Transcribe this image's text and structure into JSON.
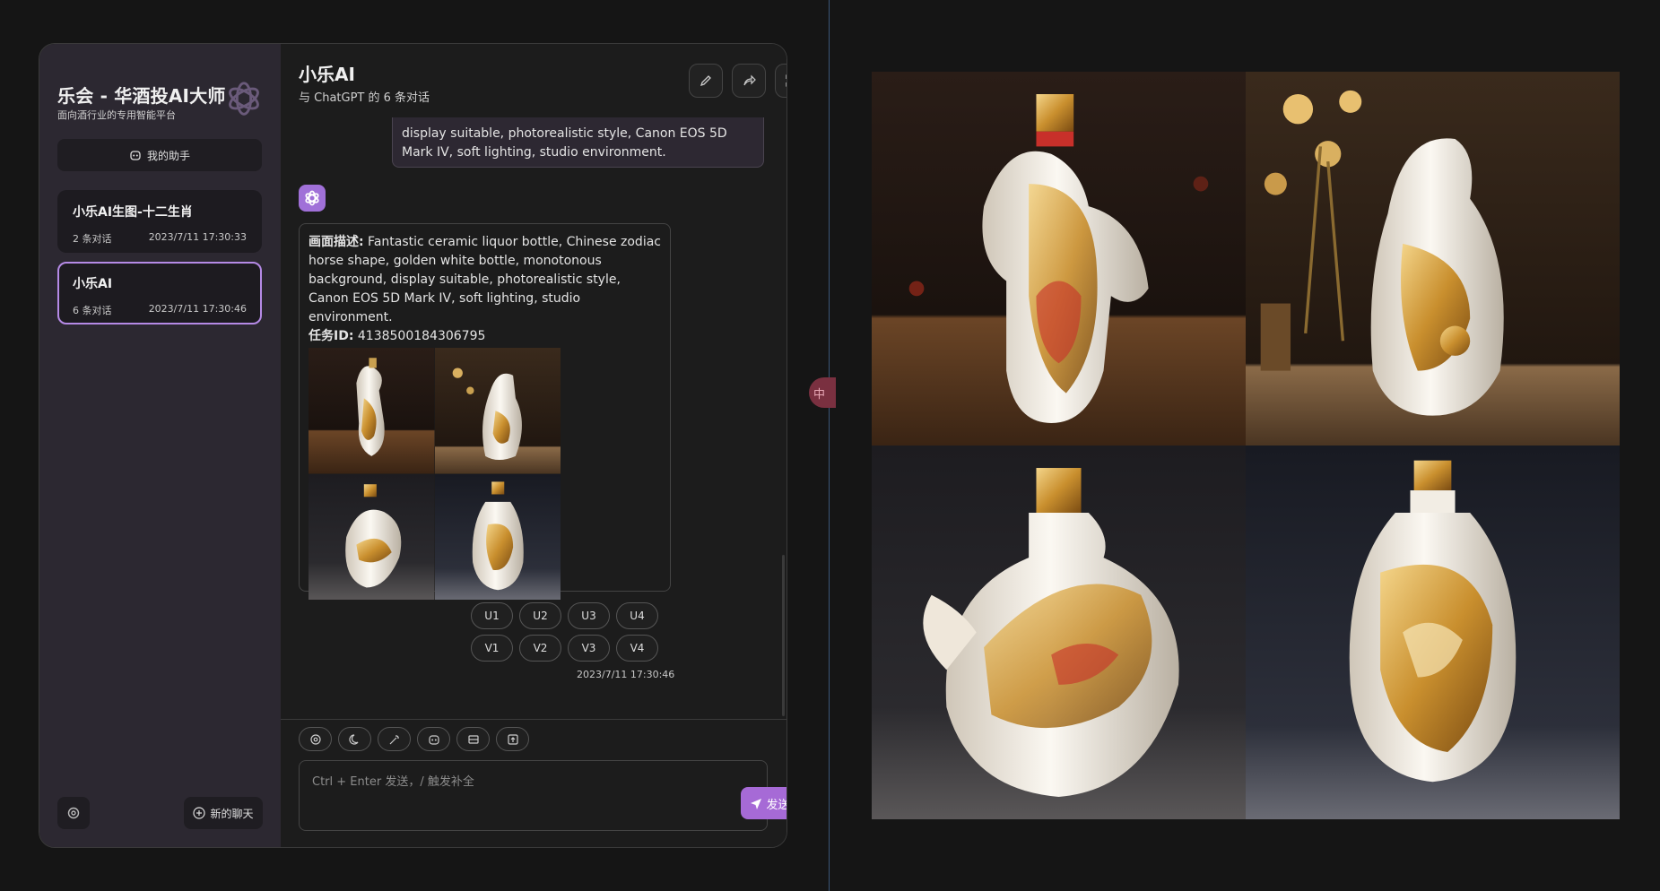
{
  "sidebar": {
    "brand_title": "乐会 - 华酒投AI大师",
    "brand_subtitle": "面向酒行业的专用智能平台",
    "assistant_button": "我的助手",
    "chats": [
      {
        "title": "小乐AI生图-十二生肖",
        "count": "2 条对话",
        "time": "2023/7/11 17:30:33"
      },
      {
        "title": "小乐AI",
        "count": "6 条对话",
        "time": "2023/7/11 17:30:46"
      }
    ],
    "new_chat_button": "新的聊天"
  },
  "header": {
    "title": "小乐AI",
    "subtitle": "与 ChatGPT 的 6 条对话"
  },
  "messages": {
    "user_text": "display suitable, photorealistic style, Canon EOS 5D Mark IV, soft lighting, studio environment.",
    "bot_label_desc": "画面描述:",
    "bot_desc": " Fantastic ceramic liquor bottle, Chinese zodiac horse shape, golden white bottle, monotonous background, display suitable, photorealistic style, Canon EOS 5D Mark IV, soft lighting, studio environment.",
    "bot_label_id": "任务ID:",
    "bot_id": " 4138500184306795",
    "upscale_buttons": [
      "U1",
      "U2",
      "U3",
      "U4"
    ],
    "variation_buttons": [
      "V1",
      "V2",
      "V3",
      "V4"
    ],
    "time": "2023/7/11 17:30:46"
  },
  "composer": {
    "placeholder": "Ctrl + Enter 发送，/ 触发补全",
    "send_label": "发送"
  },
  "floating_badge": "中",
  "colors": {
    "accent": "#a66ad6",
    "active_border": "#b58ae6",
    "sidebar_bg": "#2c2831"
  }
}
